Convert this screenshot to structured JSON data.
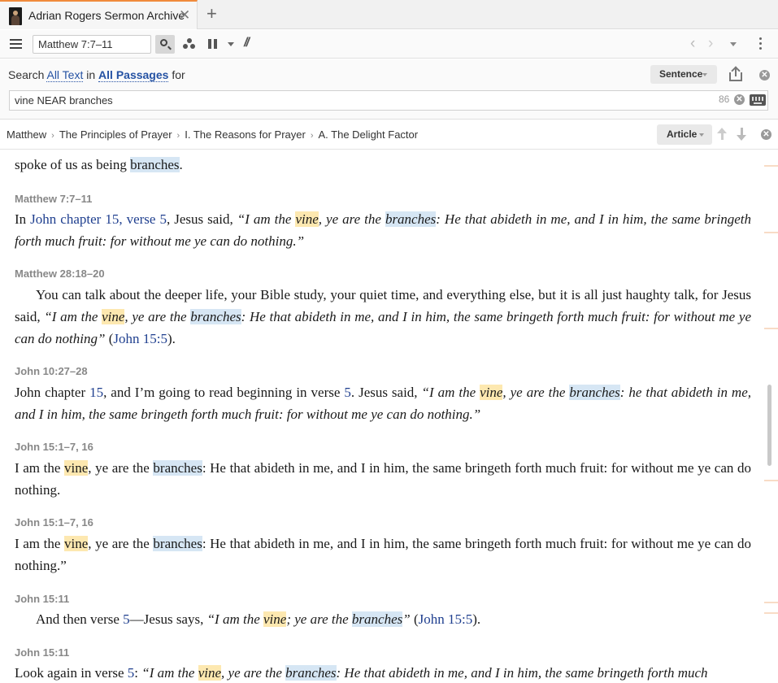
{
  "tab": {
    "title": "Adrian Rogers Sermon Archive",
    "close": "✕",
    "new_tab": "+"
  },
  "toolbar": {
    "reference": "Matthew 7:7–11",
    "parallel": "//",
    "back": "‹",
    "forward": "›"
  },
  "search": {
    "prefix": "Search",
    "scope": "All Text",
    "in_word": "in",
    "range": "All Passages",
    "for_word": "for",
    "mode_button": "Sentence",
    "query": "vine NEAR branches",
    "hit_count": "86",
    "clear": "✕"
  },
  "breadcrumb": {
    "items": [
      "Matthew",
      "The Principles of Prayer",
      "I. The Reasons for Prayer",
      "A. The Delight Factor"
    ],
    "separator": "›",
    "article_button": "Article",
    "close": "✕"
  },
  "results": {
    "partial_top": {
      "pre": "spoke of us as being ",
      "hit": "branches",
      "post": "."
    },
    "r1": {
      "ref": "Matthew 7:7–11",
      "t1": "In ",
      "lnk1": "John chapter 15, verse 5",
      "t2": ", Jesus said, ",
      "q1": "“I am the ",
      "hit1": "vine",
      "q2": ", ye are the ",
      "hit2": "branches",
      "q3": ": He that abideth in me, and I in him, the same bringeth forth much fruit: for without me ye can do nothing.”"
    },
    "r2": {
      "ref": "Matthew 28:18–20",
      "t1": "You can talk about the deeper life, your Bible study, your quiet time, and everything else, but it is all just haughty talk, for Jesus said, ",
      "q1": "“I am the ",
      "hit1": "vine",
      "q2": ", ye are the ",
      "hit2": "branches",
      "q3": ": He that abideth in me, and I in him, the same bringeth forth much fruit: for without me ye can do nothing”",
      "t2": " (",
      "lnk": "John 15:5",
      "t3": ")."
    },
    "r3": {
      "ref": "John 10:27–28",
      "t1": "John chapter ",
      "lnk1": "15",
      "t2": ", and I’m going to read beginning in verse ",
      "lnk2": "5",
      "t3": ". Jesus said, ",
      "q1": "“I am the ",
      "hit1": "vine",
      "q2": ", ye are the ",
      "hit2": "branches",
      "q3": ": he that abideth in me, and I in him, the same bringeth forth much fruit: for without me ye can do nothing.”"
    },
    "r4": {
      "ref": "John 15:1–7, 16",
      "t1": "I am the ",
      "hit1": "vine",
      "t2": ", ye are the ",
      "hit2": "branches",
      "t3": ": He that abideth in me, and I in him, the same bringeth forth much fruit: for without me ye can do nothing."
    },
    "r5": {
      "ref": "John 15:1–7, 16",
      "t1": "I am the ",
      "hit1": "vine",
      "t2": ", ye are the ",
      "hit2": "branches",
      "t3": ": He that abideth in me, and I in him, the same bringeth forth much fruit: for without me ye can do nothing.”"
    },
    "r6": {
      "ref": "John 15:11",
      "t1": "And then verse ",
      "lnk1": "5",
      "t2": "—Jesus says, ",
      "q1": "“I am the ",
      "hit1": "vine",
      "q2": "; ye are the ",
      "hit2": "branches",
      "q3": "”",
      "t3": " (",
      "lnk2": "John 15:5",
      "t4": ")."
    },
    "r7": {
      "ref": "John 15:11",
      "t1": "Look again in verse ",
      "lnk1": "5",
      "t2": ": ",
      "q1": "“I am the ",
      "hit1": "vine",
      "q2": ", ye are the ",
      "hit2": "branches",
      "q3": ": He that abideth in me, and I in him, the same bringeth forth much"
    }
  },
  "colors": {
    "tab_accent": "#f08a3c",
    "vine_highlight": "#fde8b0",
    "branches_highlight": "#d6e6f4",
    "link": "#1f3f8f"
  }
}
